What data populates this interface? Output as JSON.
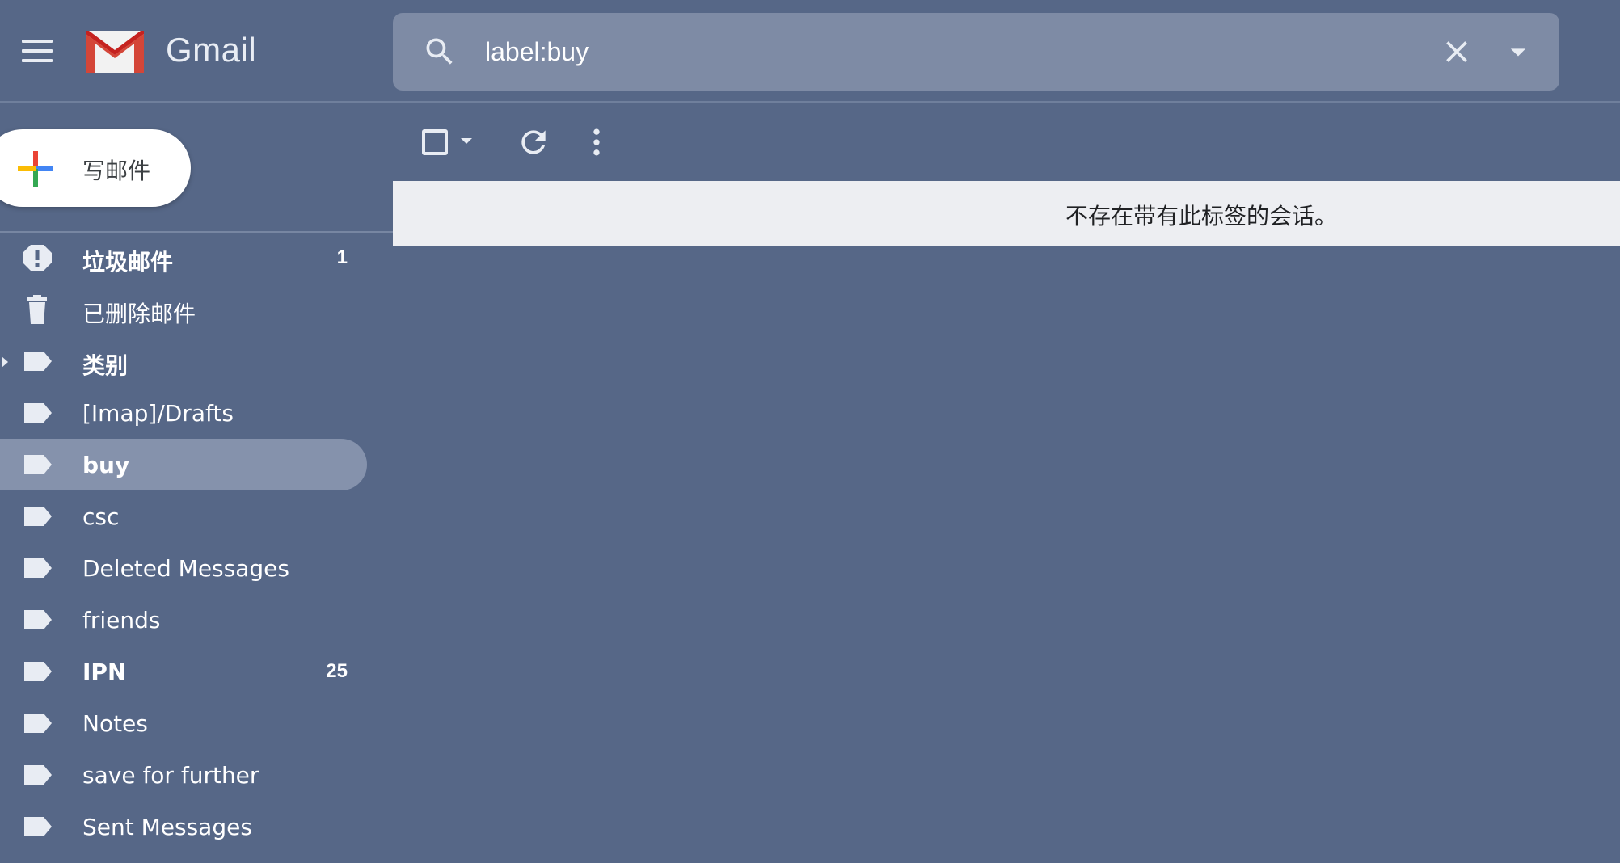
{
  "header": {
    "brand": "Gmail",
    "search": {
      "value": "label:buy",
      "placeholder": "搜索邮件"
    }
  },
  "sidebar": {
    "compose_label": "写邮件",
    "items": [
      {
        "label": "垃圾邮件",
        "count": "1",
        "icon": "spam-icon",
        "bold": true,
        "active": false,
        "expandable": false
      },
      {
        "label": "已删除邮件",
        "count": "",
        "icon": "trash-icon",
        "bold": false,
        "active": false,
        "expandable": false
      },
      {
        "label": "类别",
        "count": "",
        "icon": "label-icon",
        "bold": true,
        "active": false,
        "expandable": true
      },
      {
        "label": "[Imap]/Drafts",
        "count": "",
        "icon": "label-icon",
        "bold": false,
        "active": false,
        "expandable": false
      },
      {
        "label": "buy",
        "count": "",
        "icon": "label-icon",
        "bold": true,
        "active": true,
        "expandable": false
      },
      {
        "label": "csc",
        "count": "",
        "icon": "label-icon",
        "bold": false,
        "active": false,
        "expandable": false
      },
      {
        "label": "Deleted Messages",
        "count": "",
        "icon": "label-icon",
        "bold": false,
        "active": false,
        "expandable": false
      },
      {
        "label": "friends",
        "count": "",
        "icon": "label-icon",
        "bold": false,
        "active": false,
        "expandable": false
      },
      {
        "label": "IPN",
        "count": "25",
        "icon": "label-icon",
        "bold": true,
        "active": false,
        "expandable": false
      },
      {
        "label": "Notes",
        "count": "",
        "icon": "label-icon",
        "bold": false,
        "active": false,
        "expandable": false
      },
      {
        "label": "save for further",
        "count": "",
        "icon": "label-icon",
        "bold": false,
        "active": false,
        "expandable": false
      },
      {
        "label": "Sent Messages",
        "count": "",
        "icon": "label-icon",
        "bold": false,
        "active": false,
        "expandable": false
      }
    ]
  },
  "main": {
    "empty_message": "不存在带有此标签的会话。"
  },
  "colors": {
    "background": "#566787",
    "search_bg": "#7e8ba5",
    "active_item_bg": "#8592ac",
    "empty_bar_bg": "#edeef2"
  }
}
